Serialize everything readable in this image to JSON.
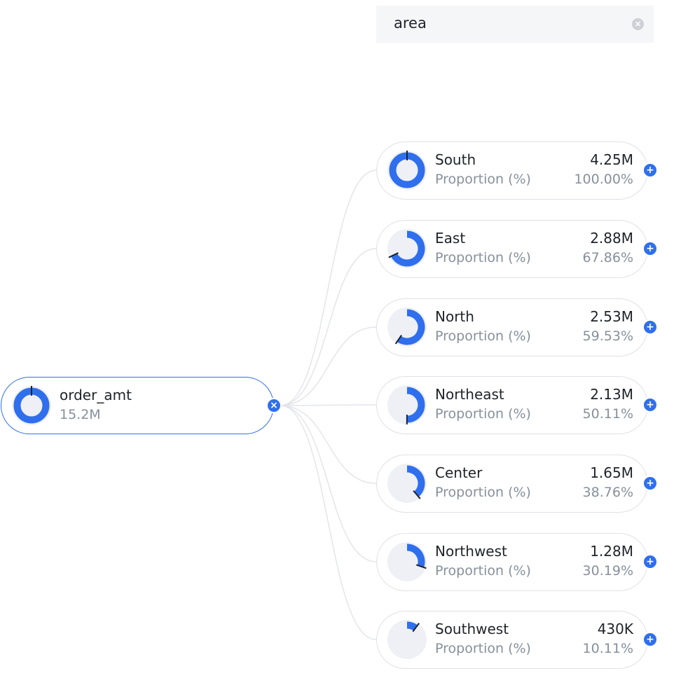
{
  "search": {
    "value": "area"
  },
  "colors": {
    "accent": "#2f6fed",
    "track": "#eef0f5",
    "marker": "#1f2329",
    "link": "#e3e5ea"
  },
  "root": {
    "name": "order_amt",
    "value": "15.2M",
    "ratio": 1.0
  },
  "chart_data": {
    "type": "tree",
    "root": "order_amt",
    "dimension": "area",
    "children": [
      {
        "name": "South",
        "value": "4.25M",
        "metric_label": "Proportion (%)",
        "pct": "100.00%",
        "ratio": 1.0
      },
      {
        "name": "East",
        "value": "2.88M",
        "metric_label": "Proportion (%)",
        "pct": "67.86%",
        "ratio": 0.6786
      },
      {
        "name": "North",
        "value": "2.53M",
        "metric_label": "Proportion (%)",
        "pct": "59.53%",
        "ratio": 0.5953
      },
      {
        "name": "Northeast",
        "value": "2.13M",
        "metric_label": "Proportion (%)",
        "pct": "50.11%",
        "ratio": 0.5011
      },
      {
        "name": "Center",
        "value": "1.65M",
        "metric_label": "Proportion (%)",
        "pct": "38.76%",
        "ratio": 0.3876
      },
      {
        "name": "Northwest",
        "value": "1.28M",
        "metric_label": "Proportion (%)",
        "pct": "30.19%",
        "ratio": 0.3019
      },
      {
        "name": "Southwest",
        "value": "430K",
        "metric_label": "Proportion (%)",
        "pct": "10.11%",
        "ratio": 0.1011
      }
    ]
  }
}
